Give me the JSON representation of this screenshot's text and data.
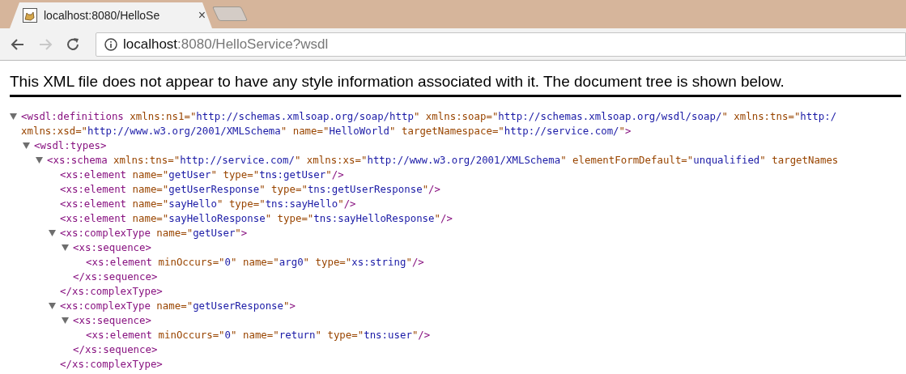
{
  "tab": {
    "title": "localhost:8080/HelloSe",
    "close": "×",
    "selected": true
  },
  "address_bar": {
    "host": "localhost",
    "path": ":8080/HelloService?wsdl"
  },
  "nav": {
    "back_disabled": false,
    "forward_disabled": true
  },
  "notice": "This XML file does not appear to have any style information associated with it. The document tree is shown below.",
  "tree": [
    {
      "expanded": true,
      "lines": [
        [
          {
            "kind": "tag",
            "text": "<wsdl:definitions"
          },
          {
            "kind": "attr",
            "text": " xmlns:ns1=\""
          },
          {
            "kind": "value",
            "text": "http://schemas.xmlsoap.org/soap/http"
          },
          {
            "kind": "attr",
            "text": "\" xmlns:soap=\""
          },
          {
            "kind": "value",
            "text": "http://schemas.xmlsoap.org/wsdl/soap/"
          },
          {
            "kind": "attr",
            "text": "\" xmlns:tns=\""
          },
          {
            "kind": "value",
            "text": "http:/"
          }
        ],
        [
          {
            "kind": "attr",
            "text": "xmlns:xsd=\""
          },
          {
            "kind": "value",
            "text": "http://www.w3.org/2001/XMLSchema"
          },
          {
            "kind": "attr",
            "text": "\" name=\""
          },
          {
            "kind": "value",
            "text": "HelloWorld"
          },
          {
            "kind": "attr",
            "text": "\" targetNamespace=\""
          },
          {
            "kind": "value",
            "text": "http://service.com/"
          },
          {
            "kind": "attr",
            "text": "\""
          },
          {
            "kind": "tag",
            "text": ">"
          }
        ]
      ],
      "children": [
        {
          "expanded": true,
          "lines": [
            [
              {
                "kind": "tag",
                "text": "<wsdl:types>"
              }
            ]
          ],
          "children": [
            {
              "expanded": true,
              "lines": [
                [
                  {
                    "kind": "tag",
                    "text": "<xs:schema"
                  },
                  {
                    "kind": "attr",
                    "text": " xmlns:tns=\""
                  },
                  {
                    "kind": "value",
                    "text": "http://service.com/"
                  },
                  {
                    "kind": "attr",
                    "text": "\" xmlns:xs=\""
                  },
                  {
                    "kind": "value",
                    "text": "http://www.w3.org/2001/XMLSchema"
                  },
                  {
                    "kind": "attr",
                    "text": "\" elementFormDefault=\""
                  },
                  {
                    "kind": "value",
                    "text": "unqualified"
                  },
                  {
                    "kind": "attr",
                    "text": "\" targetNames"
                  }
                ]
              ],
              "children": [
                {
                  "lines": [
                    [
                      {
                        "kind": "tag",
                        "text": "<xs:element"
                      },
                      {
                        "kind": "attr",
                        "text": " name=\""
                      },
                      {
                        "kind": "value",
                        "text": "getUser"
                      },
                      {
                        "kind": "attr",
                        "text": "\" type=\""
                      },
                      {
                        "kind": "value",
                        "text": "tns:getUser"
                      },
                      {
                        "kind": "attr",
                        "text": "\""
                      },
                      {
                        "kind": "tag",
                        "text": "/>"
                      }
                    ]
                  ]
                },
                {
                  "lines": [
                    [
                      {
                        "kind": "tag",
                        "text": "<xs:element"
                      },
                      {
                        "kind": "attr",
                        "text": " name=\""
                      },
                      {
                        "kind": "value",
                        "text": "getUserResponse"
                      },
                      {
                        "kind": "attr",
                        "text": "\" type=\""
                      },
                      {
                        "kind": "value",
                        "text": "tns:getUserResponse"
                      },
                      {
                        "kind": "attr",
                        "text": "\""
                      },
                      {
                        "kind": "tag",
                        "text": "/>"
                      }
                    ]
                  ]
                },
                {
                  "lines": [
                    [
                      {
                        "kind": "tag",
                        "text": "<xs:element"
                      },
                      {
                        "kind": "attr",
                        "text": " name=\""
                      },
                      {
                        "kind": "value",
                        "text": "sayHello"
                      },
                      {
                        "kind": "attr",
                        "text": "\" type=\""
                      },
                      {
                        "kind": "value",
                        "text": "tns:sayHello"
                      },
                      {
                        "kind": "attr",
                        "text": "\""
                      },
                      {
                        "kind": "tag",
                        "text": "/>"
                      }
                    ]
                  ]
                },
                {
                  "lines": [
                    [
                      {
                        "kind": "tag",
                        "text": "<xs:element"
                      },
                      {
                        "kind": "attr",
                        "text": " name=\""
                      },
                      {
                        "kind": "value",
                        "text": "sayHelloResponse"
                      },
                      {
                        "kind": "attr",
                        "text": "\" type=\""
                      },
                      {
                        "kind": "value",
                        "text": "tns:sayHelloResponse"
                      },
                      {
                        "kind": "attr",
                        "text": "\""
                      },
                      {
                        "kind": "tag",
                        "text": "/>"
                      }
                    ]
                  ]
                },
                {
                  "expanded": true,
                  "lines": [
                    [
                      {
                        "kind": "tag",
                        "text": "<xs:complexType"
                      },
                      {
                        "kind": "attr",
                        "text": " name=\""
                      },
                      {
                        "kind": "value",
                        "text": "getUser"
                      },
                      {
                        "kind": "attr",
                        "text": "\""
                      },
                      {
                        "kind": "tag",
                        "text": ">"
                      }
                    ]
                  ],
                  "children": [
                    {
                      "expanded": true,
                      "lines": [
                        [
                          {
                            "kind": "tag",
                            "text": "<xs:sequence>"
                          }
                        ]
                      ],
                      "children": [
                        {
                          "lines": [
                            [
                              {
                                "kind": "tag",
                                "text": "<xs:element"
                              },
                              {
                                "kind": "attr",
                                "text": " minOccurs=\""
                              },
                              {
                                "kind": "value",
                                "text": "0"
                              },
                              {
                                "kind": "attr",
                                "text": "\" name=\""
                              },
                              {
                                "kind": "value",
                                "text": "arg0"
                              },
                              {
                                "kind": "attr",
                                "text": "\" type=\""
                              },
                              {
                                "kind": "value",
                                "text": "xs:string"
                              },
                              {
                                "kind": "attr",
                                "text": "\""
                              },
                              {
                                "kind": "tag",
                                "text": "/>"
                              }
                            ]
                          ]
                        }
                      ],
                      "closing": [
                        {
                          "kind": "tag",
                          "text": "</xs:sequence>"
                        }
                      ]
                    }
                  ],
                  "closing": [
                    {
                      "kind": "tag",
                      "text": "</xs:complexType>"
                    }
                  ]
                },
                {
                  "expanded": true,
                  "lines": [
                    [
                      {
                        "kind": "tag",
                        "text": "<xs:complexType"
                      },
                      {
                        "kind": "attr",
                        "text": " name=\""
                      },
                      {
                        "kind": "value",
                        "text": "getUserResponse"
                      },
                      {
                        "kind": "attr",
                        "text": "\""
                      },
                      {
                        "kind": "tag",
                        "text": ">"
                      }
                    ]
                  ],
                  "children": [
                    {
                      "expanded": true,
                      "lines": [
                        [
                          {
                            "kind": "tag",
                            "text": "<xs:sequence>"
                          }
                        ]
                      ],
                      "children": [
                        {
                          "lines": [
                            [
                              {
                                "kind": "tag",
                                "text": "<xs:element"
                              },
                              {
                                "kind": "attr",
                                "text": " minOccurs=\""
                              },
                              {
                                "kind": "value",
                                "text": "0"
                              },
                              {
                                "kind": "attr",
                                "text": "\" name=\""
                              },
                              {
                                "kind": "value",
                                "text": "return"
                              },
                              {
                                "kind": "attr",
                                "text": "\" type=\""
                              },
                              {
                                "kind": "value",
                                "text": "tns:user"
                              },
                              {
                                "kind": "attr",
                                "text": "\""
                              },
                              {
                                "kind": "tag",
                                "text": "/>"
                              }
                            ]
                          ]
                        }
                      ],
                      "closing": [
                        {
                          "kind": "tag",
                          "text": "</xs:sequence>"
                        }
                      ]
                    }
                  ],
                  "closing": [
                    {
                      "kind": "tag",
                      "text": "</xs:complexType>"
                    }
                  ]
                }
              ]
            }
          ]
        }
      ]
    }
  ]
}
